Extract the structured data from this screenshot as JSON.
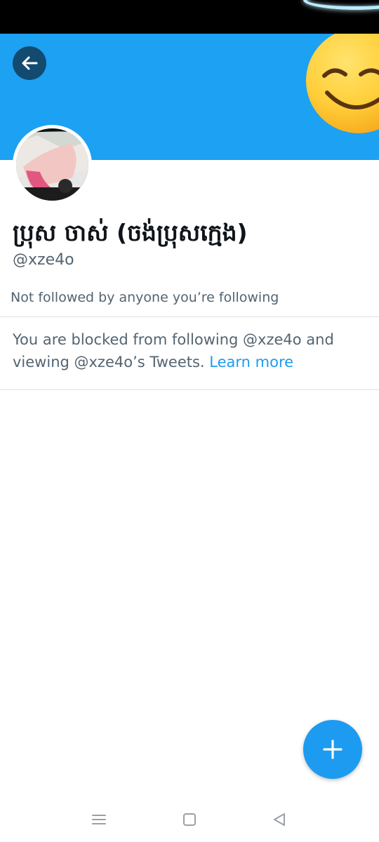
{
  "profile": {
    "display_name": "ប្រុស ចាស់ (ចង់ប្រុសក្មេង)",
    "handle": "@xze4o",
    "followers_note": "Not followed by anyone you’re following"
  },
  "blocked": {
    "message": "You are blocked from following @xze4o and viewing @xze4o’s Tweets.",
    "learn_more": "Learn more"
  },
  "icons": {
    "back": "back-arrow-icon",
    "compose": "plus-icon",
    "nav_menu": "menu-icon",
    "nav_home": "home-square-icon",
    "nav_back": "back-triangle-icon"
  },
  "colors": {
    "banner": "#1da1f2",
    "accent": "#1d9bf0",
    "text_primary": "#0f1419",
    "text_secondary": "#536471"
  }
}
